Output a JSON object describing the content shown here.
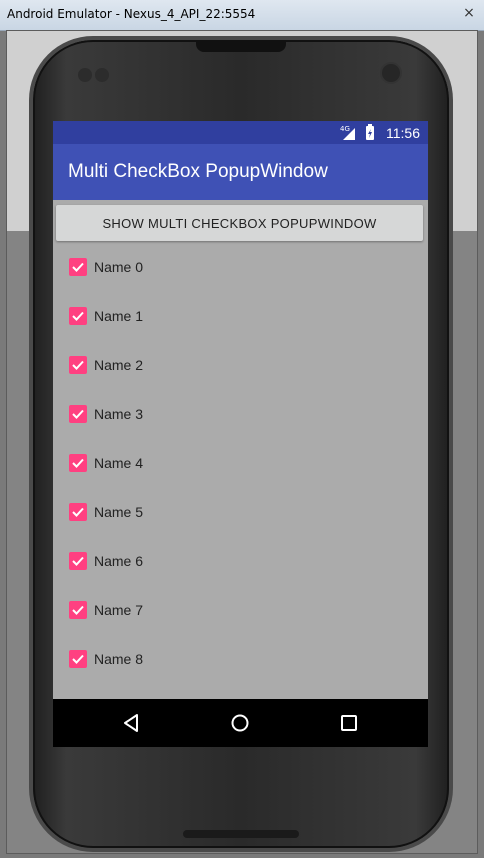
{
  "window": {
    "title": "Android Emulator - Nexus_4_API_22:5554",
    "close_glyph": "×"
  },
  "status_bar": {
    "network": "4G",
    "time": "11:56"
  },
  "app_bar": {
    "title": "Multi CheckBox PopupWindow"
  },
  "show_button": {
    "label": "SHOW MULTI CHECKBOX POPUPWINDOW"
  },
  "items": [
    {
      "label": "Name 0",
      "checked": true
    },
    {
      "label": "Name 1",
      "checked": true
    },
    {
      "label": "Name 2",
      "checked": true
    },
    {
      "label": "Name 3",
      "checked": true
    },
    {
      "label": "Name 4",
      "checked": true
    },
    {
      "label": "Name 5",
      "checked": true
    },
    {
      "label": "Name 6",
      "checked": true
    },
    {
      "label": "Name 7",
      "checked": true
    },
    {
      "label": "Name 8",
      "checked": true
    }
  ],
  "nav_bar": {
    "icons": [
      "back-icon",
      "home-icon",
      "recents-icon"
    ]
  },
  "colors": {
    "accent": "#ff4081",
    "primary": "#3f51b5",
    "primary_dark": "#303f9f"
  }
}
